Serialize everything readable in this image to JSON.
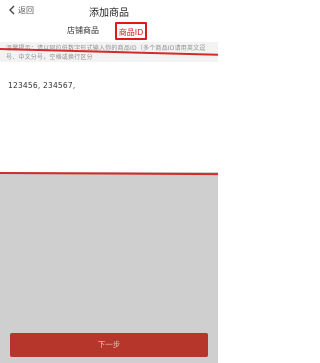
{
  "nav": {
    "back_label": "返回",
    "title": "添加商品"
  },
  "tabs": [
    {
      "label": "店铺商品",
      "active": false
    },
    {
      "label": "商品ID",
      "active": true
    }
  ],
  "hint": {
    "text": "温馨提示：请以阿拉伯数字形式输入你的商品ID（多个商品ID请用英文逗号、中文分号，空格或换行区分"
  },
  "input": {
    "value": "123456, 234567,"
  },
  "footer": {
    "next_label": "下一步"
  },
  "colors": {
    "accent_red": "#d62a2a",
    "button_red": "#b6362c",
    "overlay_gray": "#cfcfcf"
  }
}
